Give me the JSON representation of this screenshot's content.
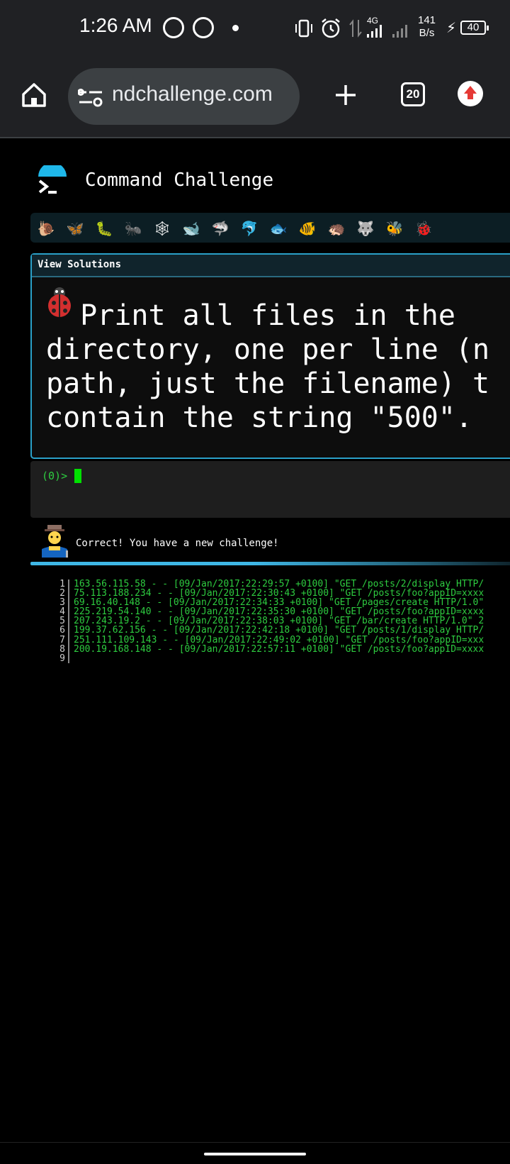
{
  "status_bar": {
    "time": "1:26 AM",
    "network": "4G",
    "data_rate_value": "141",
    "data_rate_unit": "B/s",
    "battery": "40"
  },
  "browser": {
    "url": "ndchallenge.com",
    "tab_count": "20"
  },
  "site": {
    "title": "Command Challenge"
  },
  "levels": [
    {
      "icon": "snail-icon",
      "glyph": "🐌"
    },
    {
      "icon": "butterfly-icon",
      "glyph": "🦋"
    },
    {
      "icon": "caterpillar-icon",
      "glyph": "🐛"
    },
    {
      "icon": "ant-icon",
      "glyph": "🐜"
    },
    {
      "icon": "spider-web-icon",
      "glyph": "🕸"
    },
    {
      "icon": "whale-icon",
      "glyph": "🐋"
    },
    {
      "icon": "shark-icon",
      "glyph": "🦈"
    },
    {
      "icon": "dolphin-icon",
      "glyph": "🐬"
    },
    {
      "icon": "fish-icon",
      "glyph": "🐟"
    },
    {
      "icon": "tropical-fish-icon",
      "glyph": "🐠"
    },
    {
      "icon": "hedgehog-icon",
      "glyph": "🦔"
    },
    {
      "icon": "wolf-icon",
      "glyph": "🐺"
    },
    {
      "icon": "bee-icon",
      "glyph": "🐝"
    },
    {
      "icon": "ladybug-icon",
      "glyph": "🐞"
    }
  ],
  "challenge": {
    "view_solutions_label": "View Solutions",
    "text": "  Print all files in the \ndirectory, one per line (n\npath, just the filename) t\ncontain the string \"500\"."
  },
  "terminal": {
    "prompt": "(0)>"
  },
  "result": {
    "message": "Correct! You have a new challenge!"
  },
  "output_lines": [
    {
      "n": "1",
      "text": "163.56.115.58 - - [09/Jan/2017:22:29:57 +0100] \"GET /posts/2/display HTTP/"
    },
    {
      "n": "2",
      "text": "75.113.188.234 - - [09/Jan/2017:22:30:43 +0100] \"GET /posts/foo?appID=xxxx"
    },
    {
      "n": "3",
      "text": "69.16.40.148 - - [09/Jan/2017:22:34:33 +0100] \"GET /pages/create HTTP/1.0\""
    },
    {
      "n": "4",
      "text": "225.219.54.140 - - [09/Jan/2017:22:35:30 +0100] \"GET /posts/foo?appID=xxxx"
    },
    {
      "n": "5",
      "text": "207.243.19.2 - - [09/Jan/2017:22:38:03 +0100] \"GET /bar/create HTTP/1.0\" 2"
    },
    {
      "n": "6",
      "text": "199.37.62.156 - - [09/Jan/2017:22:42:18 +0100] \"GET /posts/1/display HTTP/"
    },
    {
      "n": "7",
      "text": "251.111.109.143 - - [09/Jan/2017:22:49:02 +0100] \"GET /posts/foo?appID=xxx"
    },
    {
      "n": "8",
      "text": "200.19.168.148 - - [09/Jan/2017:22:57:11 +0100] \"GET /posts/foo?appID=xxxx"
    },
    {
      "n": "9",
      "text": ""
    }
  ],
  "colors": {
    "accent": "#2aa0c8",
    "terminal_green": "#2ecc40",
    "browser_bar": "#202124"
  }
}
